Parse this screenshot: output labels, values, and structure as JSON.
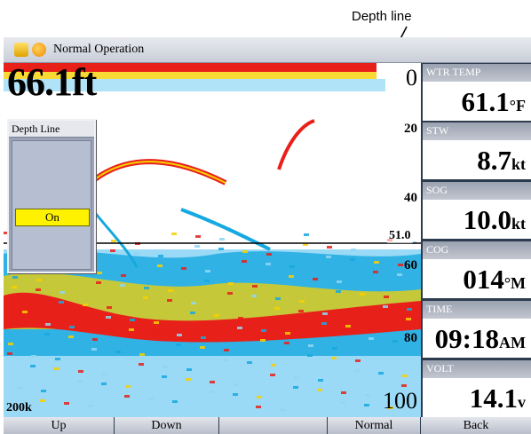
{
  "callout": {
    "label": "Depth line"
  },
  "window": {
    "title": "Normal Operation"
  },
  "sonar": {
    "depth_value": "66.1",
    "depth_unit": "ft",
    "frequency": "200k",
    "scale": [
      "0",
      "20",
      "40",
      "60",
      "80",
      "100"
    ],
    "depth_line_value": "51.0",
    "colors": {
      "strong": "#e8201a",
      "mid": "#f7d000",
      "weak": "#16a8e0",
      "faint": "#8fd6f5"
    }
  },
  "popup": {
    "title": "Depth Line",
    "option": "On"
  },
  "fields": [
    {
      "label": "WTR TEMP",
      "value": "61.1",
      "unit": "°F"
    },
    {
      "label": "STW",
      "value": "8.7",
      "unit": "kt"
    },
    {
      "label": "SOG",
      "value": "10.0",
      "unit": "kt"
    },
    {
      "label": "COG",
      "value": "014",
      "unit": "°M"
    },
    {
      "label": "TIME",
      "value": "09:18",
      "unit": "AM"
    },
    {
      "label": "VOLT",
      "value": "14.1",
      "unit": "v"
    }
  ],
  "softkeys": [
    "Up",
    "Down",
    "",
    "Normal",
    "Back"
  ]
}
